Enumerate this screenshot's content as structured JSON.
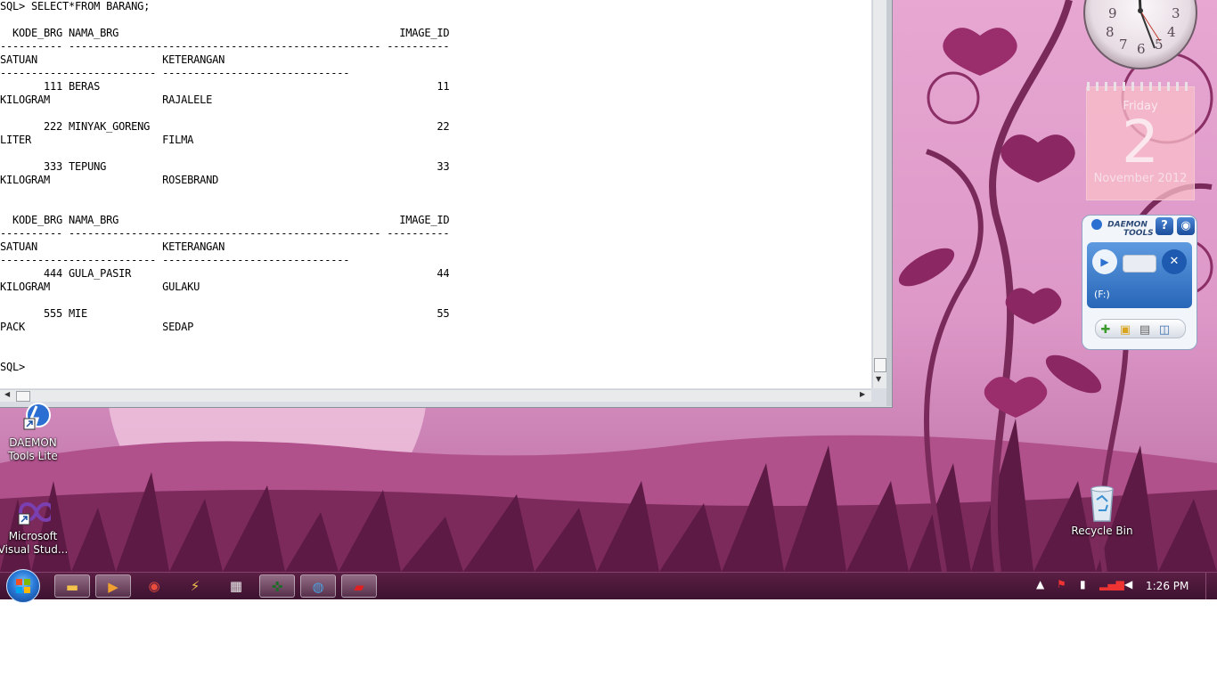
{
  "console": {
    "lines": [
      "SQL> SELECT*FROM BARANG;",
      "",
      "  KODE_BRG NAMA_BRG                                             IMAGE_ID",
      "---------- -------------------------------------------------- ----------",
      "SATUAN                    KETERANGAN",
      "------------------------- ------------------------------",
      "       111 BERAS                                                      11",
      "KILOGRAM                  RAJALELE",
      "",
      "       222 MINYAK_GORENG                                              22",
      "LITER                     FILMA",
      "",
      "       333 TEPUNG                                                     33",
      "KILOGRAM                  ROSEBRAND",
      "",
      "",
      "  KODE_BRG NAMA_BRG                                             IMAGE_ID",
      "---------- -------------------------------------------------- ----------",
      "SATUAN                    KETERANGAN",
      "------------------------- ------------------------------",
      "       444 GULA_PASIR                                                 44",
      "KILOGRAM                  GULAKU",
      "",
      "       555 MIE                                                        55",
      "PACK                      SEDAP",
      "",
      "",
      "SQL>"
    ]
  },
  "desktop_icons": [
    {
      "label1": "DAEMON",
      "label2": "Tools Lite",
      "icon": "daemon-tools-icon"
    },
    {
      "label1": "Microsoft",
      "label2": "Visual Stud...",
      "icon": "visual-studio-icon"
    },
    {
      "label1": "Recycle Bin",
      "label2": "",
      "icon": "recycle-bin-icon"
    }
  ],
  "clock_gadget": {
    "numbers": [
      "9",
      "8",
      "7",
      "6",
      "5",
      "4",
      "3"
    ]
  },
  "calendar_gadget": {
    "weekday": "Friday",
    "day": "2",
    "month_year": "November 2012"
  },
  "daemon_gadget": {
    "logo_line1": "DAEMON",
    "logo_line2": "TOOLS",
    "help": "?",
    "drive_label": "(F:)"
  },
  "taskbar": {
    "buttons": [
      "file-explorer-icon",
      "media-player-icon",
      "chrome-icon",
      "flash-icon",
      "movie-maker-icon",
      "sql-plus-icon",
      "paint-icon",
      "acrobat-icon"
    ],
    "clock": "1:26 PM"
  },
  "colors": {
    "taskbar": "#4a1838",
    "wallpaper": "#e3a2cf",
    "console_bg": "#ffffff"
  }
}
